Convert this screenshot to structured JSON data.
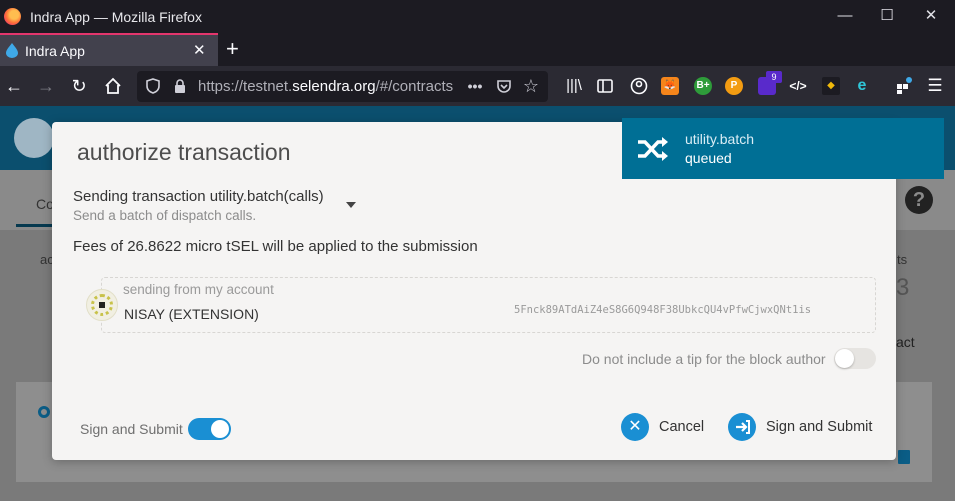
{
  "browser": {
    "window_title": "Indra App — Mozilla Firefox",
    "tab_title": "Indra App",
    "url_prefix": "https://testnet.",
    "url_domain": "selendra.org",
    "url_path": "/#/contracts",
    "extension_badge_count": "9",
    "icons": [
      "firefox-logo",
      "minimize",
      "maximize",
      "close",
      "back",
      "forward",
      "reload",
      "home",
      "shield",
      "lock",
      "more",
      "pocket",
      "bookmark-star",
      "library",
      "sidebar",
      "account",
      "metamask",
      "extension",
      "extension",
      "extension",
      "dev-tools",
      "extension",
      "edge-extension",
      "extensions-puzzle",
      "menu"
    ],
    "accent_color": "#e3366d"
  },
  "background_app": {
    "tab_label": "Co",
    "header_color": "#0b4f6e",
    "fragments": {
      "left_ac": "ac",
      "right_ts": "ts",
      "right_3": "3",
      "right_act": "act"
    }
  },
  "modal": {
    "title": "authorize transaction",
    "call_summary": "Sending transaction utility.batch(calls)",
    "call_description": "Send a batch of dispatch calls.",
    "fees_text": "Fees of 26.8622 micro tSEL will be applied to the submission",
    "account": {
      "label": "sending from my account",
      "name": "NISAY (EXTENSION)",
      "address": "5Fnck89ATdAiZ4eS8G6Q948F38UbkcQU4vPfwCjwxQNt1is"
    },
    "tip": {
      "label": "Do not include a tip for the block author",
      "enabled": false
    },
    "sign_toggle": {
      "label": "Sign and Submit",
      "enabled": true
    },
    "buttons": {
      "cancel": "Cancel",
      "submit": "Sign and Submit"
    },
    "accent_color": "#1a8fd3"
  },
  "notification": {
    "title": "utility.batch",
    "status": "queued",
    "color": "#006f95"
  }
}
